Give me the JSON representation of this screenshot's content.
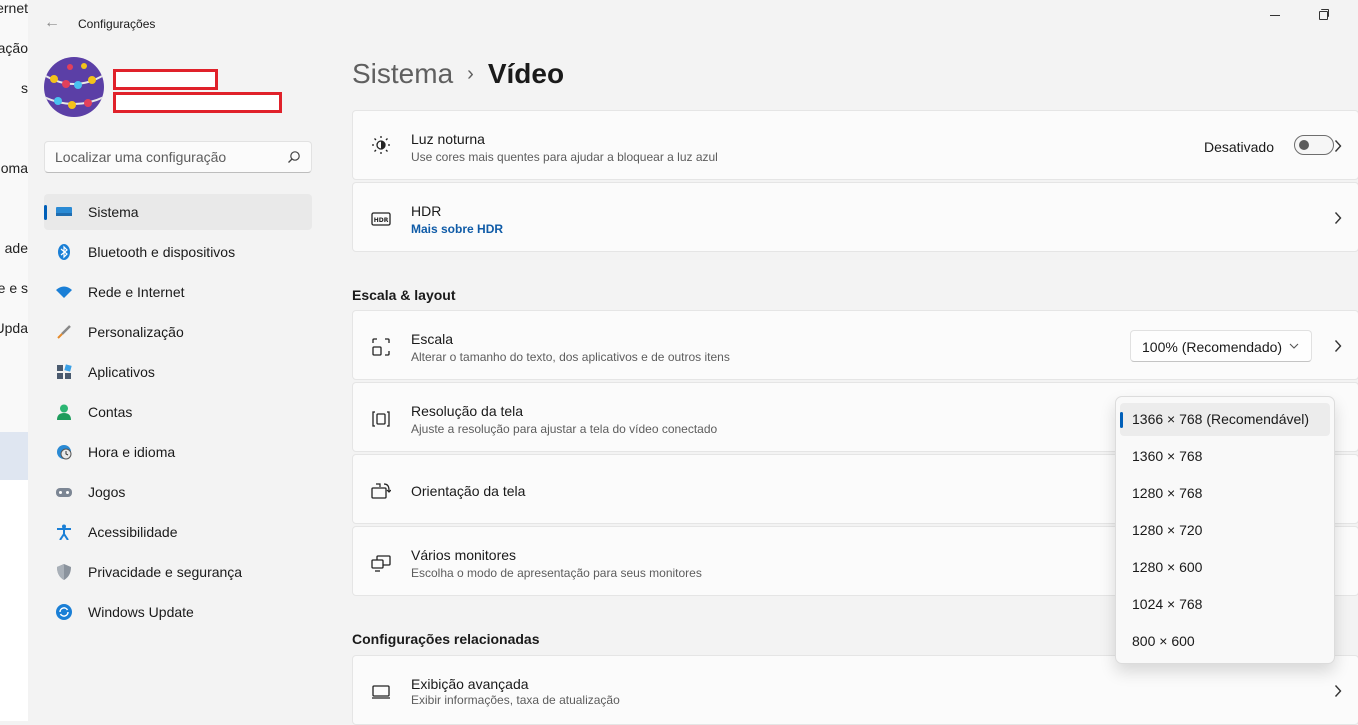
{
  "background_window": {
    "fragments": [
      "ernet",
      "ação",
      "s",
      "oma",
      "ade",
      "e e s",
      "Upda"
    ]
  },
  "app": {
    "title": "Configurações",
    "back_label": "←"
  },
  "search": {
    "placeholder": "Localizar uma configuração"
  },
  "sidebar": {
    "items": [
      {
        "label": "Sistema",
        "icon": "display-icon",
        "active": true
      },
      {
        "label": "Bluetooth e dispositivos",
        "icon": "bluetooth-icon"
      },
      {
        "label": "Rede e Internet",
        "icon": "wifi-icon"
      },
      {
        "label": "Personalização",
        "icon": "brush-icon"
      },
      {
        "label": "Aplicativos",
        "icon": "apps-icon"
      },
      {
        "label": "Contas",
        "icon": "person-icon"
      },
      {
        "label": "Hora e idioma",
        "icon": "clock-globe-icon"
      },
      {
        "label": "Jogos",
        "icon": "gamepad-icon"
      },
      {
        "label": "Acessibilidade",
        "icon": "accessibility-icon"
      },
      {
        "label": "Privacidade e segurança",
        "icon": "shield-icon"
      },
      {
        "label": "Windows Update",
        "icon": "update-icon"
      }
    ]
  },
  "breadcrumb": {
    "parent": "Sistema",
    "separator": "›",
    "current": "Vídeo"
  },
  "night_light": {
    "title": "Luz noturna",
    "desc": "Use cores mais quentes para ajudar a bloquear a luz azul",
    "state_label": "Desativado"
  },
  "hdr": {
    "title": "HDR",
    "link": "Mais sobre HDR"
  },
  "scale_section": {
    "title": "Escala & layout"
  },
  "scale": {
    "title": "Escala",
    "desc": "Alterar o tamanho do texto, dos aplicativos e de outros itens",
    "value": "100% (Recomendado)"
  },
  "resolution": {
    "title": "Resolução da tela",
    "desc": "Ajuste a resolução para ajustar a tela do  vídeo conectado",
    "options": [
      "1366 × 768 (Recomendável)",
      "1360 × 768",
      "1280 × 768",
      "1280 × 720",
      "1280 × 600",
      "1024 × 768",
      "800 × 600"
    ],
    "selected_index": 0
  },
  "orientation": {
    "title": "Orientação da tela"
  },
  "multi_monitor": {
    "title": "Vários monitores",
    "desc": "Escolha o modo de apresentação para seus monitores"
  },
  "related_section": {
    "title": "Configurações relacionadas"
  },
  "advanced": {
    "title": "Exibição avançada",
    "desc": "Exibir informações, taxa de atualização"
  },
  "colors": {
    "accent": "#005fb8",
    "link": "#0f5ba7",
    "redaction": "#e0212a"
  }
}
